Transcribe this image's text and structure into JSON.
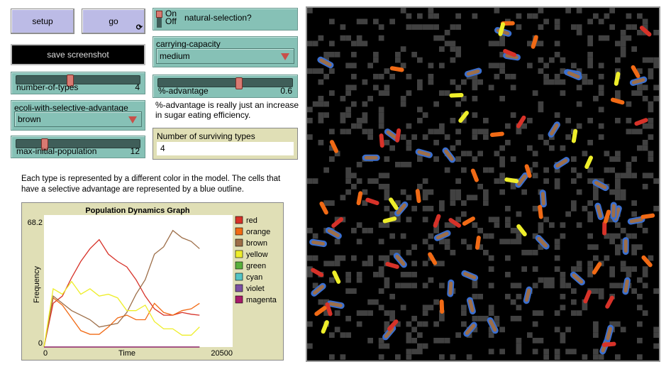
{
  "buttons": {
    "setup": "setup",
    "go": "go",
    "save_screenshot": "save screenshot"
  },
  "sliders": [
    {
      "label": "number-of-types",
      "value": "4",
      "min": 1,
      "max": 8,
      "num": 4
    },
    {
      "label": "max-initial-population",
      "value": "12",
      "min": 1,
      "max": 50,
      "num": 12
    },
    {
      "label": "%-advantage",
      "value": "0.6",
      "min": 0,
      "max": 1,
      "num": 0.6
    }
  ],
  "switch": {
    "label": "natural-selection?",
    "on": "On",
    "off": "Off",
    "state": "on"
  },
  "choosers": {
    "ecoli": {
      "label": "ecoli-with-selective-advantage",
      "value": "brown"
    },
    "capacity": {
      "label": "carrying-capacity",
      "value": "medium"
    }
  },
  "notes": {
    "advantage": "%-advantage is really just an increase in sugar eating efficiency.",
    "types": "Each type is represented by a different color in the model. The cells that have a selective advantage are represented by a blue outline."
  },
  "monitor": {
    "label": "Number of surviving types",
    "value": "4"
  },
  "colors": {
    "widget": "#86c1b6",
    "button": "#bcbbe6",
    "plot_bg": "#e0dfb6",
    "patch_gray": "#414141",
    "advantage_outline": "#3a6fd0"
  },
  "chart_data": {
    "type": "line",
    "title": "Population Dynamics Graph",
    "xlabel": "Time",
    "ylabel": "Frequency",
    "xlim": [
      0,
      20500
    ],
    "ylim": [
      0,
      68.2
    ],
    "xtick_labels": [
      "0",
      "20500"
    ],
    "ytick_labels": [
      "0",
      "68.2"
    ],
    "legend": "right",
    "x": [
      0,
      1000,
      2000,
      3000,
      4000,
      5000,
      6000,
      7000,
      8000,
      9000,
      10000,
      11000,
      12000,
      13000,
      14000,
      15000,
      16000,
      16900
    ],
    "series": [
      {
        "name": "red",
        "color": "#d73229",
        "values": [
          0,
          24,
          28,
          38,
          47,
          54,
          59,
          51,
          47,
          44,
          37,
          28,
          21,
          17.5,
          17.5,
          19,
          18,
          17.5
        ]
      },
      {
        "name": "orange",
        "color": "#f16a15",
        "values": [
          0,
          27,
          23,
          16,
          9,
          7,
          7,
          11,
          16,
          17.5,
          15,
          15,
          24,
          19,
          17.5,
          20,
          21,
          24
        ]
      },
      {
        "name": "brown",
        "color": "#9d6e48",
        "values": [
          0,
          28,
          24,
          20,
          17.5,
          15,
          11,
          12,
          13,
          19,
          29,
          37,
          51,
          55,
          64,
          60,
          58,
          54
        ]
      },
      {
        "name": "yellow",
        "color": "#eeee2a",
        "values": [
          0,
          32,
          29,
          36,
          29,
          32,
          28,
          29,
          27,
          20,
          20,
          23,
          14,
          10,
          10,
          6.5,
          6.5,
          11
        ]
      },
      {
        "name": "green",
        "color": "#59b03c",
        "values": [
          0,
          0,
          0,
          0,
          0,
          0,
          0,
          0,
          0,
          0,
          0,
          0,
          0,
          0,
          0,
          0,
          0,
          0
        ]
      },
      {
        "name": "cyan",
        "color": "#54c4c4",
        "values": [
          0,
          0,
          0,
          0,
          0,
          0,
          0,
          0,
          0,
          0,
          0,
          0,
          0,
          0,
          0,
          0,
          0,
          0
        ]
      },
      {
        "name": "violet",
        "color": "#7c50a4",
        "values": [
          0,
          0,
          0,
          0,
          0,
          0,
          0,
          0,
          0,
          0,
          0,
          0,
          0,
          0,
          0,
          0,
          0,
          0
        ]
      },
      {
        "name": "magenta",
        "color": "#a71b6a",
        "values": [
          0,
          0,
          0,
          0,
          0,
          0,
          0,
          0,
          0,
          0,
          0,
          0,
          0,
          0,
          0,
          0,
          0,
          0
        ]
      }
    ]
  }
}
